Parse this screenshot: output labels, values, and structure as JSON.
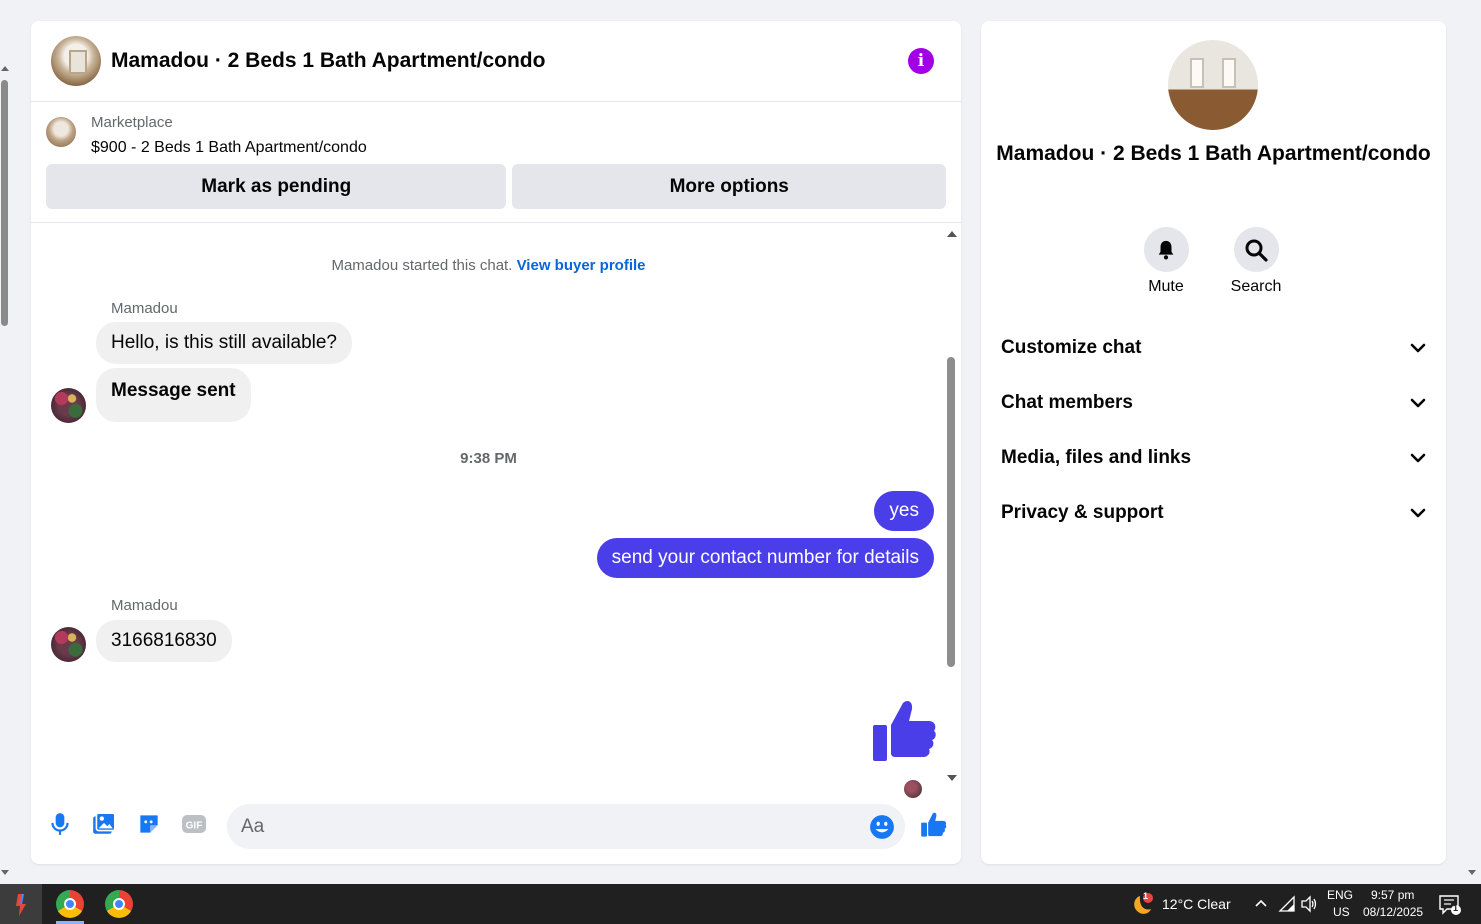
{
  "chat": {
    "title": "Mamadou · 2 Beds 1 Bath Apartment/condo",
    "marketplace_label": "Marketplace",
    "listing": "$900 - 2 Beds 1 Bath Apartment/condo",
    "mark_pending": "Mark as pending",
    "more_options": "More options",
    "started": "Mamadou started this chat.",
    "view_profile": "View buyer profile",
    "messages": [
      {
        "sender": "Mamadou",
        "text": "Hello, is this still available?"
      },
      {
        "text": "Message sent"
      },
      {
        "time": "9:38 PM"
      },
      {
        "out": true,
        "text": "yes"
      },
      {
        "out": true,
        "text": "send your contact number for details"
      },
      {
        "sender": "Mamadou",
        "text": "3166816830"
      }
    ],
    "input_placeholder": "Aa"
  },
  "info": {
    "name": "Mamadou · 2 Beds 1 Bath Apartment/condo",
    "mute": "Mute",
    "search": "Search",
    "sections": [
      "Customize chat",
      "Chat members",
      "Media, files and links",
      "Privacy & support"
    ]
  },
  "taskbar": {
    "weather": "12°C  Clear",
    "weather_badge": "1",
    "lang": "ENG",
    "region": "US",
    "time": "9:57 pm",
    "date": "08/12/2025",
    "notif_count": "1"
  },
  "colors": {
    "accent_blue": "#0a66d8",
    "outgoing_bubble": "#4a3ee8",
    "info_purple": "#a100e6",
    "like_blue": "#1877f2"
  }
}
